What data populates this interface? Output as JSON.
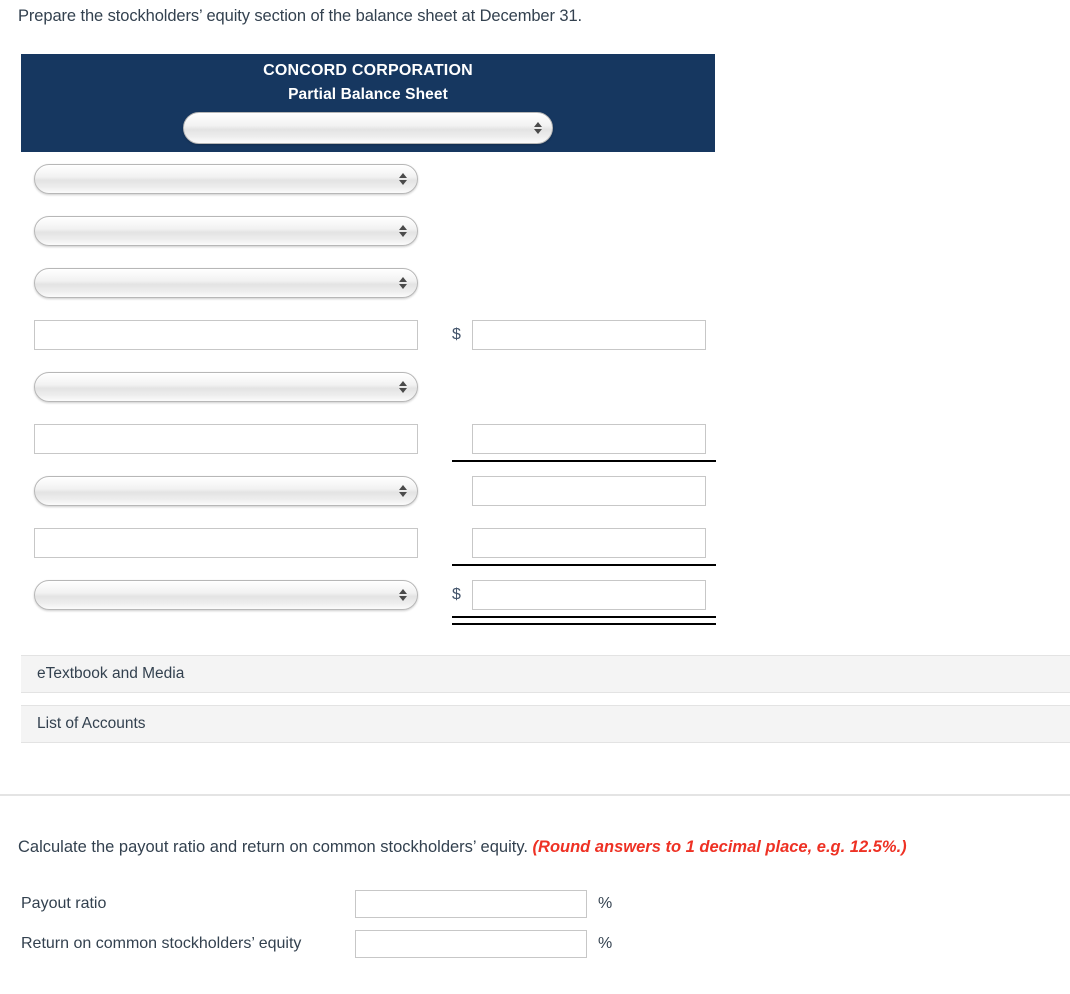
{
  "prompt": "Prepare the stockholders’ equity section of the balance sheet at December 31.",
  "statement": {
    "company": "CONCORD CORPORATION",
    "subtitle": "Partial Balance Sheet",
    "header_select": {
      "value": "",
      "icon": "updown-arrows-icon"
    },
    "rows": [
      {
        "type": "select",
        "value": "",
        "amount": null,
        "amount_prefix": "",
        "rule": "none"
      },
      {
        "type": "select",
        "value": "",
        "amount": null,
        "amount_prefix": "",
        "rule": "none"
      },
      {
        "type": "select",
        "value": "",
        "amount": null,
        "amount_prefix": "",
        "rule": "none"
      },
      {
        "type": "text",
        "value": "",
        "amount": "",
        "amount_prefix": "$",
        "rule": "none"
      },
      {
        "type": "select",
        "value": "",
        "amount": null,
        "amount_prefix": "",
        "rule": "none"
      },
      {
        "type": "text",
        "value": "",
        "amount": "",
        "amount_prefix": "",
        "rule": "single"
      },
      {
        "type": "select",
        "value": "",
        "amount": "",
        "amount_prefix": "",
        "rule": "none"
      },
      {
        "type": "text",
        "value": "",
        "amount": "",
        "amount_prefix": "",
        "rule": "single"
      },
      {
        "type": "select",
        "value": "",
        "amount": "",
        "amount_prefix": "$",
        "rule": "double"
      }
    ]
  },
  "bars": [
    {
      "label": "eTextbook and Media"
    },
    {
      "label": "List of Accounts"
    }
  ],
  "ratios": {
    "prompt_text": "Calculate the payout ratio and return on common stockholders’ equity. ",
    "note": "(Round answers to 1 decimal place, e.g. 12.5%.)",
    "note_color": "#ee3124",
    "items": [
      {
        "label": "Payout ratio",
        "value": "",
        "suffix": "%"
      },
      {
        "label": "Return on common stockholders’ equity",
        "value": "",
        "suffix": "%"
      }
    ]
  },
  "colors": {
    "header_navy": "#163760",
    "text": "#33414f",
    "bar_bg": "#f4f4f4",
    "rule_black": "#000000"
  }
}
